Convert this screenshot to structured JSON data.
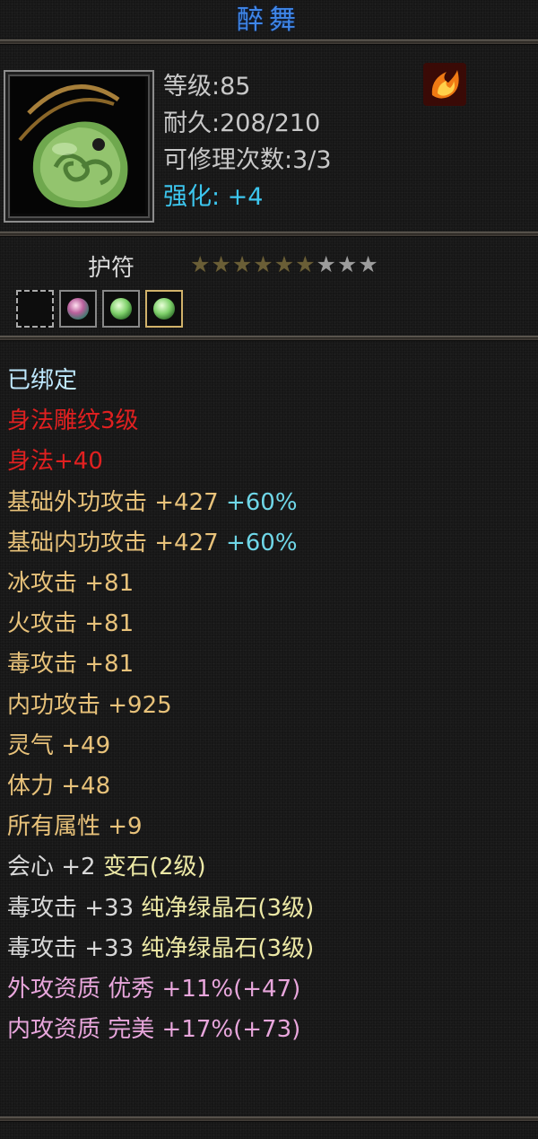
{
  "item": {
    "name": "醉舞",
    "level": "等级:85",
    "durability": "耐久:208/210",
    "repair_count": "可修理次数:3/3",
    "enhance": "强化: +4",
    "type": "护符",
    "icon": "jade-pendant-icon",
    "element_badge": "fire-icon"
  },
  "stars": {
    "total": 9,
    "lit": 6
  },
  "slots": [
    {
      "state": "empty",
      "icon": "empty-gem-slot"
    },
    {
      "state": "filled",
      "icon": "variegated-gem-icon"
    },
    {
      "state": "filled",
      "icon": "green-crystal-gem-icon"
    },
    {
      "state": "filled",
      "icon": "green-crystal-gem-icon"
    }
  ],
  "colors": {
    "title": "#3f86e8",
    "enhance": "#3cc6ee",
    "red": "#e02020",
    "orange": "#e8c27a",
    "yellow": "#ede9a6",
    "blue": "#6fd7e8",
    "pink": "#e8a6dc"
  },
  "properties": {
    "bound": "已绑定",
    "engrave": "身法雕纹3级",
    "agility": "身法+40",
    "outer_attack": "基础外功攻击 +427",
    "outer_attack_pct": "+60%",
    "inner_attack": "基础内功攻击 +427",
    "inner_attack_pct": "+60%",
    "ice": "冰攻击 +81",
    "fire": "火攻击 +81",
    "poison": "毒攻击 +81",
    "inner_power": "内功攻击 +925",
    "spirit": "灵气 +49",
    "stamina": "体力 +48",
    "all_attr": "所有属性 +9",
    "crit_stat": "会心 +2",
    "crit_gem": "变石(2级)",
    "poison_gem1_stat": "毒攻击 +33",
    "poison_gem1_name": "纯净绿晶石(3级)",
    "poison_gem2_stat": "毒攻击 +33",
    "poison_gem2_name": "纯净绿晶石(3级)",
    "quality_outer": "外攻资质 优秀 +11%(+47)",
    "quality_inner": "内攻资质 完美 +17%(+73)"
  }
}
